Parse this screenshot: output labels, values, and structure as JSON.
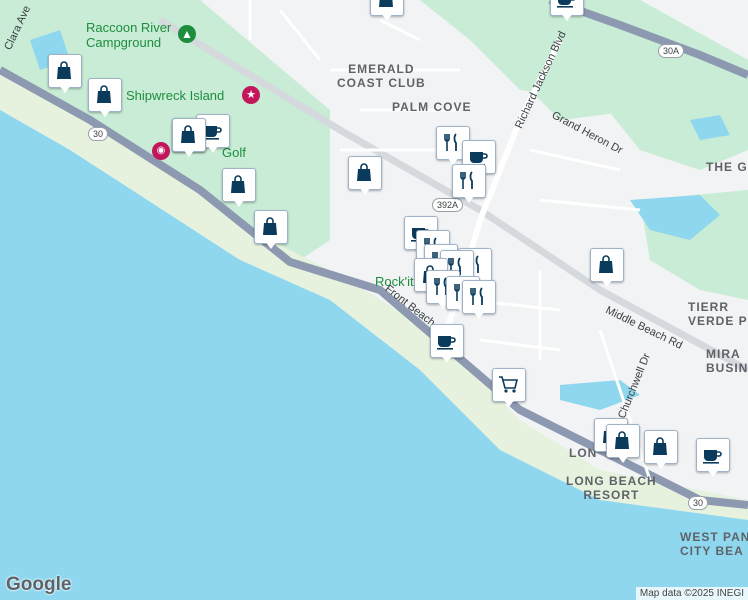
{
  "map": {
    "area_labels": [
      {
        "id": "emerald-coast-club",
        "lines": [
          "EMERALD",
          "COAST CLUB"
        ]
      },
      {
        "id": "palm-cove",
        "lines": [
          "PALM COVE"
        ]
      },
      {
        "id": "the-g",
        "lines": [
          "THE G"
        ]
      },
      {
        "id": "tierra-verde",
        "lines": [
          "TIERR",
          "VERDE P"
        ]
      },
      {
        "id": "mira-business",
        "lines": [
          "MIRA",
          "BUSIN"
        ]
      },
      {
        "id": "long-beach-resort",
        "lines": [
          "LONG BEACH",
          "RESORT"
        ]
      },
      {
        "id": "lon",
        "lines": [
          "LON"
        ]
      },
      {
        "id": "west-panama-city-beach",
        "lines": [
          "WEST PAN",
          "CITY BEA"
        ]
      }
    ],
    "poi_labels": [
      {
        "id": "raccoon-river-campground",
        "lines": [
          "Raccoon River",
          "Campground"
        ],
        "style": "green"
      },
      {
        "id": "shipwreck-island",
        "lines": [
          "Shipwreck Island"
        ],
        "style": "green"
      },
      {
        "id": "golf",
        "lines": [
          "Golf"
        ],
        "style": "green"
      },
      {
        "id": "rockit",
        "lines": [
          "Rock'it"
        ],
        "style": "green"
      }
    ],
    "road_labels": [
      {
        "id": "clara-ave",
        "text": "Clara Ave"
      },
      {
        "id": "richard-jackson-blvd",
        "text": "Richard Jackson Blvd"
      },
      {
        "id": "grand-heron-dr",
        "text": "Grand Heron Dr"
      },
      {
        "id": "middle-beach-rd",
        "text": "Middle Beach Rd"
      },
      {
        "id": "front-beach",
        "text": "Front Beach"
      },
      {
        "id": "churchwell-dr",
        "text": "Churchwell Dr"
      }
    ],
    "shields": [
      {
        "id": "shield-30-west",
        "text": "30"
      },
      {
        "id": "shield-30a",
        "text": "30A"
      },
      {
        "id": "shield-392a",
        "text": "392A"
      },
      {
        "id": "shield-30-east",
        "text": "30"
      }
    ],
    "markers": [
      {
        "id": "m1",
        "icon": "shopping-bag"
      },
      {
        "id": "m2",
        "icon": "shopping-bag"
      },
      {
        "id": "m3",
        "icon": "shopping-bag"
      },
      {
        "id": "m4",
        "icon": "shopping-bag"
      },
      {
        "id": "m5",
        "icon": "coffee-cup"
      },
      {
        "id": "m6",
        "icon": "shopping-bag"
      },
      {
        "id": "m7",
        "icon": "shopping-bag"
      },
      {
        "id": "m8",
        "icon": "coffee-cup"
      },
      {
        "id": "m9",
        "icon": "shopping-bag"
      },
      {
        "id": "m10",
        "icon": "shopping-bag"
      },
      {
        "id": "m11",
        "icon": "fork-knife"
      },
      {
        "id": "m12",
        "icon": "coffee-cup"
      },
      {
        "id": "m13",
        "icon": "fork-knife"
      },
      {
        "id": "m14",
        "icon": "coffee-cup"
      },
      {
        "id": "m15",
        "icon": "fork-knife"
      },
      {
        "id": "m16",
        "icon": "fork-knife"
      },
      {
        "id": "m17",
        "icon": "fork-knife"
      },
      {
        "id": "m18",
        "icon": "fork-knife"
      },
      {
        "id": "m19",
        "icon": "shopping-bag"
      },
      {
        "id": "m20",
        "icon": "fork-knife"
      },
      {
        "id": "m21",
        "icon": "fork-knife"
      },
      {
        "id": "m22",
        "icon": "fork-knife"
      },
      {
        "id": "m23",
        "icon": "coffee-cup"
      },
      {
        "id": "m24",
        "icon": "shopping-cart"
      },
      {
        "id": "m25",
        "icon": "shopping-bag"
      },
      {
        "id": "m26",
        "icon": "shopping-bag"
      },
      {
        "id": "m27",
        "icon": "shopping-bag"
      },
      {
        "id": "m28",
        "icon": "shopping-bag"
      },
      {
        "id": "m29",
        "icon": "coffee-cup"
      }
    ],
    "colors": {
      "water": "#8ed7ef",
      "land": "#f1f3f4",
      "park": "#c8ecd5",
      "beach": "#f5efd0",
      "highway": "#8c99b0",
      "marker_icon": "#0b3b5c"
    }
  },
  "footer": {
    "logo": "Google",
    "attribution": "Map data ©2025 INEGI"
  }
}
